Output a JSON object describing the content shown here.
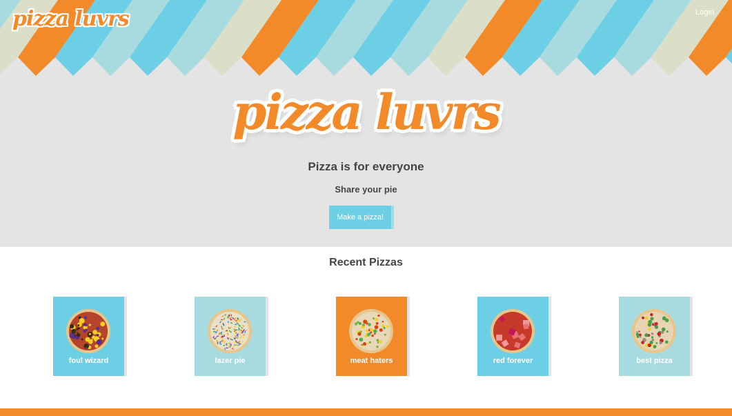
{
  "nav": {
    "logo_text": "pizza luvrs",
    "login_label": "Login"
  },
  "hero": {
    "logo_text": "pizza luvrs",
    "tagline": "Pizza is for everyone",
    "subtagline": "Share your pie",
    "cta_label": "Make a pizza!"
  },
  "recent": {
    "title": "Recent Pizzas",
    "pizzas": [
      {
        "name": "foul wizard",
        "card_color": "#6ccfe6",
        "sauce_color": "#b5442a"
      },
      {
        "name": "lazer pie",
        "card_color": "#a8dbe0",
        "sauce_color": "#e8e0c8"
      },
      {
        "name": "meat haters",
        "card_color": "#f28a2a",
        "sauce_color": "#e8d8b8"
      },
      {
        "name": "red forever",
        "card_color": "#6ccfe6",
        "sauce_color": "#c73a2b"
      },
      {
        "name": "best pizza",
        "card_color": "#a8dbe0",
        "sauce_color": "#e6d4b4"
      }
    ]
  },
  "colors": {
    "orange": "#f28a2a",
    "blue": "#6ccfe6",
    "teal": "#a8dbe0",
    "beige": "#dcdfc8",
    "hero_bg": "#e4e4e4"
  }
}
